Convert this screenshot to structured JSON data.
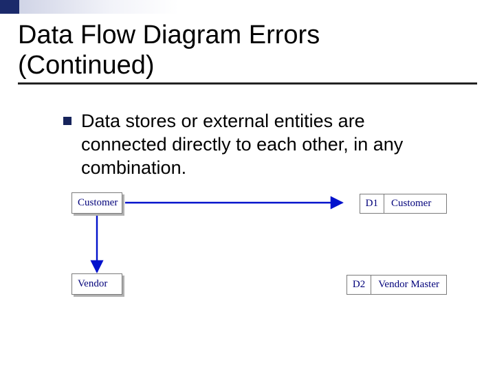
{
  "header": {
    "title": "Data Flow Diagram Errors\n(Continued)"
  },
  "bullet": {
    "text": "Data stores or external entities are connected directly to each other, in any combination."
  },
  "diagram": {
    "entities": {
      "customer": "Customer",
      "vendor": "Vendor"
    },
    "datastores": {
      "ds1_id": "D1",
      "ds1_label": "Customer",
      "ds2_id": "D2",
      "ds2_label": "Vendor Master"
    },
    "arrows": [
      {
        "from": "customer-entity",
        "to": "customer-datastore"
      },
      {
        "from": "customer-entity",
        "to": "vendor-entity"
      }
    ],
    "accent_color": "#1b2a6b",
    "arrow_color": "#0011cc"
  }
}
